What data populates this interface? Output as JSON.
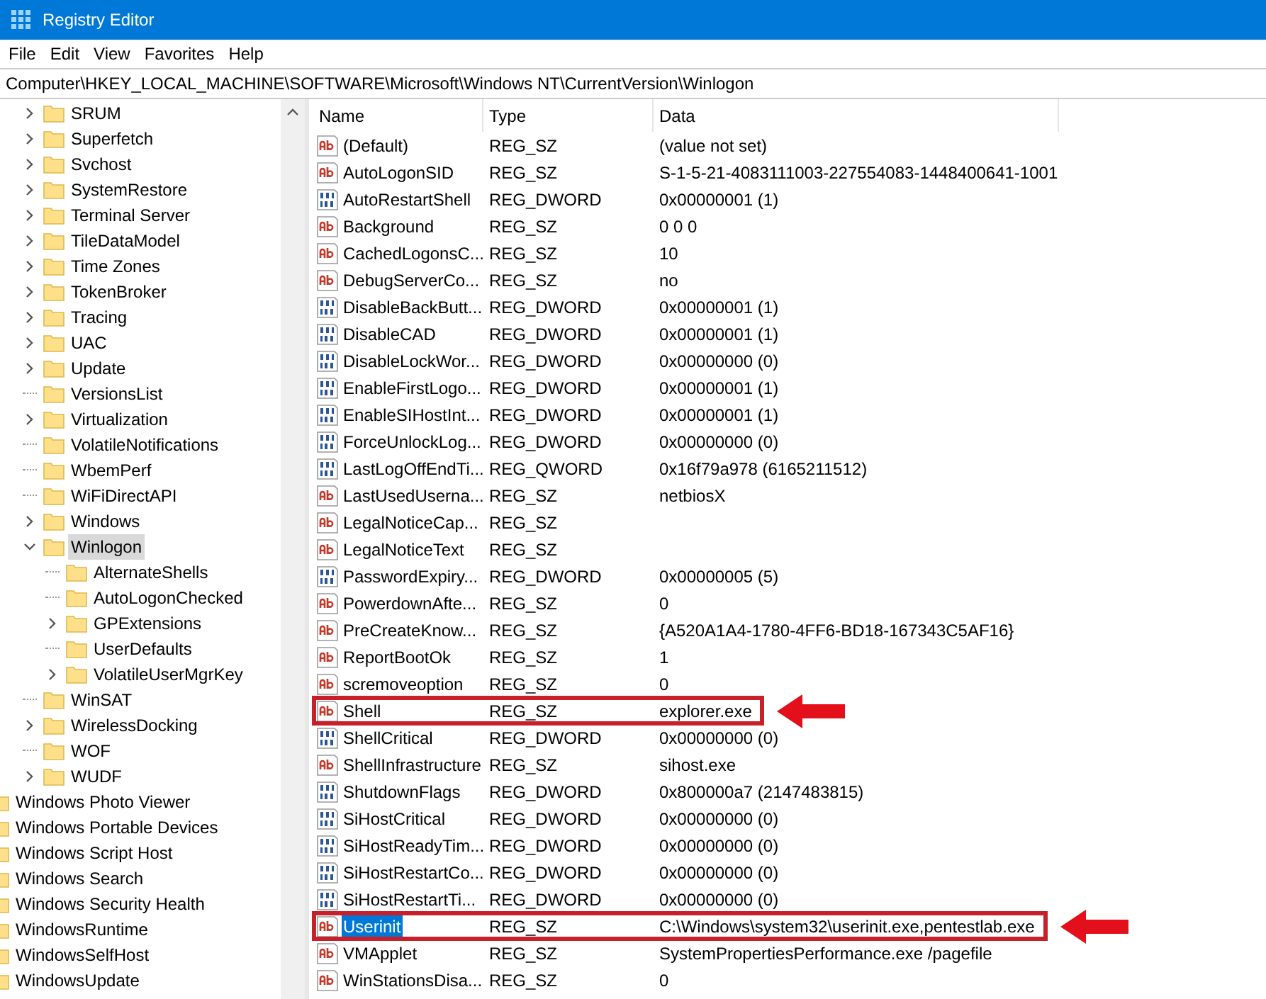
{
  "window": {
    "title": "Registry Editor"
  },
  "menu": [
    "File",
    "Edit",
    "View",
    "Favorites",
    "Help"
  ],
  "address": "Computer\\HKEY_LOCAL_MACHINE\\SOFTWARE\\Microsoft\\Windows NT\\CurrentVersion\\Winlogon",
  "tree": {
    "items": [
      {
        "label": "SRUM",
        "expandable": true,
        "selected": false
      },
      {
        "label": "Superfetch",
        "expandable": true,
        "selected": false
      },
      {
        "label": "Svchost",
        "expandable": true,
        "selected": false
      },
      {
        "label": "SystemRestore",
        "expandable": true,
        "selected": false
      },
      {
        "label": "Terminal Server",
        "expandable": true,
        "selected": false
      },
      {
        "label": "TileDataModel",
        "expandable": true,
        "selected": false
      },
      {
        "label": "Time Zones",
        "expandable": true,
        "selected": false
      },
      {
        "label": "TokenBroker",
        "expandable": true,
        "selected": false
      },
      {
        "label": "Tracing",
        "expandable": true,
        "selected": false
      },
      {
        "label": "UAC",
        "expandable": true,
        "selected": false
      },
      {
        "label": "Update",
        "expandable": true,
        "selected": false
      },
      {
        "label": "VersionsList",
        "expandable": false,
        "selected": false
      },
      {
        "label": "Virtualization",
        "expandable": true,
        "selected": false
      },
      {
        "label": "VolatileNotifications",
        "expandable": false,
        "selected": false
      },
      {
        "label": "WbemPerf",
        "expandable": false,
        "selected": false
      },
      {
        "label": "WiFiDirectAPI",
        "expandable": false,
        "selected": false
      },
      {
        "label": "Windows",
        "expandable": true,
        "selected": false
      },
      {
        "label": "Winlogon",
        "expandable": true,
        "expanded": true,
        "selected": true,
        "children": [
          {
            "label": "AlternateShells",
            "expandable": false,
            "selected": false
          },
          {
            "label": "AutoLogonChecked",
            "expandable": false,
            "selected": false
          },
          {
            "label": "GPExtensions",
            "expandable": true,
            "selected": false
          },
          {
            "label": "UserDefaults",
            "expandable": false,
            "selected": false
          },
          {
            "label": "VolatileUserMgrKey",
            "expandable": true,
            "selected": false
          }
        ]
      },
      {
        "label": "WinSAT",
        "expandable": false,
        "selected": false
      },
      {
        "label": "WirelessDocking",
        "expandable": true,
        "selected": false
      },
      {
        "label": "WOF",
        "expandable": false,
        "selected": false
      },
      {
        "label": "WUDF",
        "expandable": true,
        "selected": false
      }
    ],
    "outer_items": [
      {
        "label": "Windows Photo Viewer"
      },
      {
        "label": "Windows Portable Devices"
      },
      {
        "label": "Windows Script Host"
      },
      {
        "label": "Windows Search"
      },
      {
        "label": "Windows Security Health"
      },
      {
        "label": "WindowsRuntime"
      },
      {
        "label": "WindowsSelfHost"
      },
      {
        "label": "WindowsUpdate"
      }
    ]
  },
  "table": {
    "columns": [
      "Name",
      "Type",
      "Data"
    ],
    "rows": [
      {
        "kind": "string",
        "name": "(Default)",
        "type": "REG_SZ",
        "data": "(value not set)",
        "highlighted": false,
        "selected": false
      },
      {
        "kind": "string",
        "name": "AutoLogonSID",
        "type": "REG_SZ",
        "data": "S-1-5-21-4083111003-227554083-1448400641-1001",
        "highlighted": false,
        "selected": false
      },
      {
        "kind": "binary",
        "name": "AutoRestartShell",
        "type": "REG_DWORD",
        "data": "0x00000001 (1)",
        "highlighted": false,
        "selected": false
      },
      {
        "kind": "string",
        "name": "Background",
        "type": "REG_SZ",
        "data": "0 0 0",
        "highlighted": false,
        "selected": false
      },
      {
        "kind": "string",
        "name": "CachedLogonsC...",
        "type": "REG_SZ",
        "data": "10",
        "highlighted": false,
        "selected": false
      },
      {
        "kind": "string",
        "name": "DebugServerCo...",
        "type": "REG_SZ",
        "data": "no",
        "highlighted": false,
        "selected": false
      },
      {
        "kind": "binary",
        "name": "DisableBackButt...",
        "type": "REG_DWORD",
        "data": "0x00000001 (1)",
        "highlighted": false,
        "selected": false
      },
      {
        "kind": "binary",
        "name": "DisableCAD",
        "type": "REG_DWORD",
        "data": "0x00000001 (1)",
        "highlighted": false,
        "selected": false
      },
      {
        "kind": "binary",
        "name": "DisableLockWor...",
        "type": "REG_DWORD",
        "data": "0x00000000 (0)",
        "highlighted": false,
        "selected": false
      },
      {
        "kind": "binary",
        "name": "EnableFirstLogo...",
        "type": "REG_DWORD",
        "data": "0x00000001 (1)",
        "highlighted": false,
        "selected": false
      },
      {
        "kind": "binary",
        "name": "EnableSIHostInt...",
        "type": "REG_DWORD",
        "data": "0x00000001 (1)",
        "highlighted": false,
        "selected": false
      },
      {
        "kind": "binary",
        "name": "ForceUnlockLog...",
        "type": "REG_DWORD",
        "data": "0x00000000 (0)",
        "highlighted": false,
        "selected": false
      },
      {
        "kind": "binary",
        "name": "LastLogOffEndTi...",
        "type": "REG_QWORD",
        "data": "0x16f79a978 (6165211512)",
        "highlighted": false,
        "selected": false
      },
      {
        "kind": "string",
        "name": "LastUsedUserna...",
        "type": "REG_SZ",
        "data": "netbiosX",
        "highlighted": false,
        "selected": false
      },
      {
        "kind": "string",
        "name": "LegalNoticeCap...",
        "type": "REG_SZ",
        "highlighted": false,
        "selected": false
      },
      {
        "kind": "string",
        "name": "LegalNoticeText",
        "type": "REG_SZ",
        "highlighted": false,
        "selected": false
      },
      {
        "kind": "binary",
        "name": "PasswordExpiry...",
        "type": "REG_DWORD",
        "data": "0x00000005 (5)",
        "highlighted": false,
        "selected": false
      },
      {
        "kind": "string",
        "name": "PowerdownAfte...",
        "type": "REG_SZ",
        "data": "0",
        "highlighted": false,
        "selected": false
      },
      {
        "kind": "string",
        "name": "PreCreateKnow...",
        "type": "REG_SZ",
        "data": "{A520A1A4-1780-4FF6-BD18-167343C5AF16}",
        "highlighted": false,
        "selected": false
      },
      {
        "kind": "string",
        "name": "ReportBootOk",
        "type": "REG_SZ",
        "data": "1",
        "highlighted": false,
        "selected": false
      },
      {
        "kind": "string",
        "name": "scremoveoption",
        "type": "REG_SZ",
        "data": "0",
        "highlighted": false,
        "selected": false
      },
      {
        "kind": "string",
        "name": "Shell",
        "type": "REG_SZ",
        "data": "explorer.exe",
        "highlighted": true,
        "selected": false
      },
      {
        "kind": "binary",
        "name": "ShellCritical",
        "type": "REG_DWORD",
        "data": "0x00000000 (0)",
        "highlighted": false,
        "selected": false
      },
      {
        "kind": "string",
        "name": "ShellInfrastructure",
        "type": "REG_SZ",
        "data": "sihost.exe",
        "highlighted": false,
        "selected": false
      },
      {
        "kind": "binary",
        "name": "ShutdownFlags",
        "type": "REG_DWORD",
        "data": "0x800000a7 (2147483815)",
        "highlighted": false,
        "selected": false
      },
      {
        "kind": "binary",
        "name": "SiHostCritical",
        "type": "REG_DWORD",
        "data": "0x00000000 (0)",
        "highlighted": false,
        "selected": false
      },
      {
        "kind": "binary",
        "name": "SiHostReadyTim...",
        "type": "REG_DWORD",
        "data": "0x00000000 (0)",
        "highlighted": false,
        "selected": false
      },
      {
        "kind": "binary",
        "name": "SiHostRestartCo...",
        "type": "REG_DWORD",
        "data": "0x00000000 (0)",
        "highlighted": false,
        "selected": false
      },
      {
        "kind": "binary",
        "name": "SiHostRestartTi...",
        "type": "REG_DWORD",
        "data": "0x00000000 (0)",
        "highlighted": false,
        "selected": false
      },
      {
        "kind": "string",
        "name": "Userinit",
        "type": "REG_SZ",
        "data": "C:\\Windows\\system32\\userinit.exe,pentestlab.exe",
        "highlighted": true,
        "selected": true
      },
      {
        "kind": "string",
        "name": "VMApplet",
        "type": "REG_SZ",
        "data": "SystemPropertiesPerformance.exe /pagefile",
        "highlighted": false,
        "selected": false
      },
      {
        "kind": "string",
        "name": "WinStationsDisa...",
        "type": "REG_SZ",
        "data": "0",
        "highlighted": false,
        "selected": false
      }
    ]
  }
}
